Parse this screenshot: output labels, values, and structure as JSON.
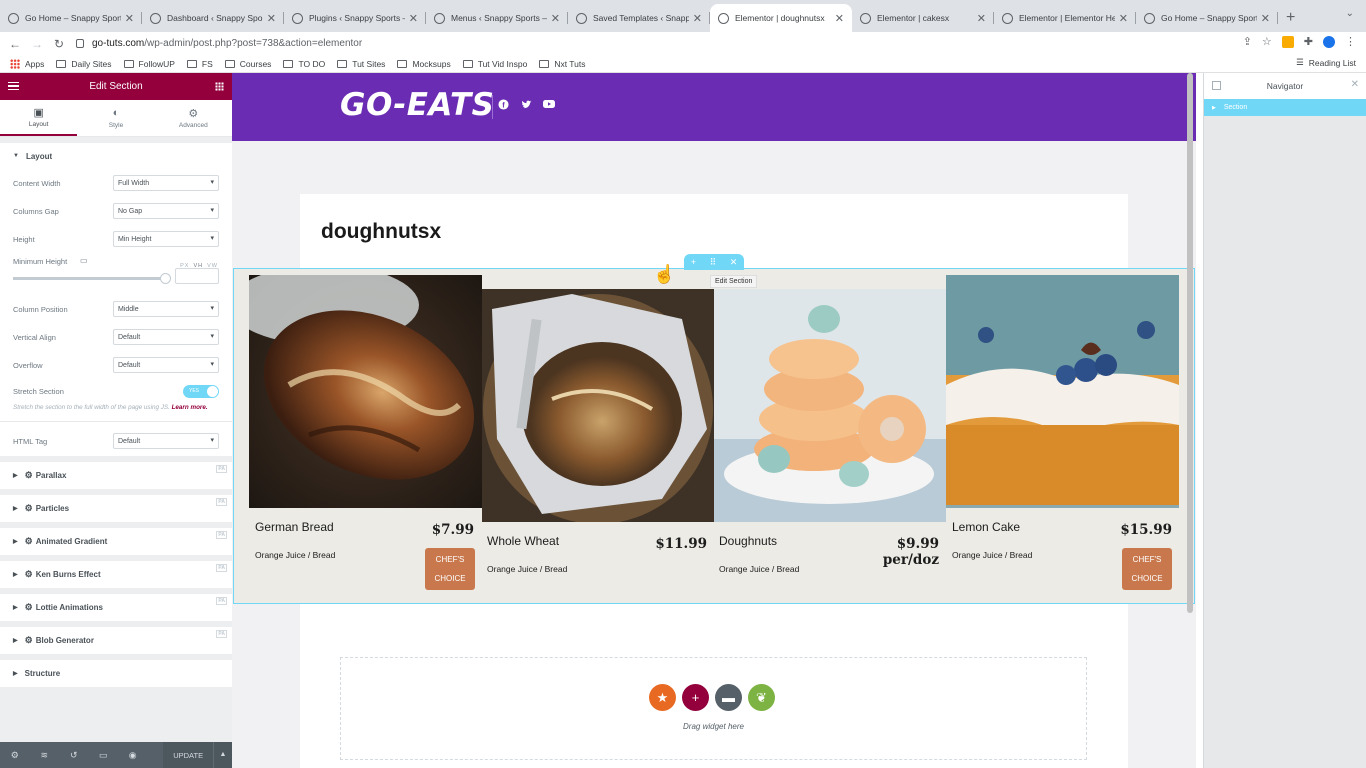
{
  "browser": {
    "tabs": [
      {
        "title": "Go Home – Snappy Sports"
      },
      {
        "title": "Dashboard ‹ Snappy Sports"
      },
      {
        "title": "Plugins ‹ Snappy Sports —"
      },
      {
        "title": "Menus ‹ Snappy Sports —"
      },
      {
        "title": "Saved Templates ‹ Snappy"
      },
      {
        "title": "Elementor | doughnutsx",
        "active": true
      },
      {
        "title": "Elementor | cakesx"
      },
      {
        "title": "Elementor | Elementor He"
      },
      {
        "title": "Go Home – Snappy Sports"
      }
    ],
    "url_host": "go-tuts.com",
    "url_path": "/wp-admin/post.php?post=738&action=elementor",
    "bookmarks": [
      "Apps",
      "Daily Sites",
      "FollowUP",
      "FS",
      "Courses",
      "TO DO",
      "Tut Sites",
      "Mocksups",
      "Tut Vid Inspo",
      "Nxt Tuts"
    ],
    "reading_list": "Reading List"
  },
  "panel": {
    "title": "Edit Section",
    "tabs": [
      "Layout",
      "Style",
      "Advanced"
    ],
    "layout_section": "Layout",
    "fields": {
      "content_width": {
        "label": "Content Width",
        "value": "Full Width"
      },
      "columns_gap": {
        "label": "Columns Gap",
        "value": "No Gap"
      },
      "height": {
        "label": "Height",
        "value": "Min Height"
      },
      "min_height": {
        "label": "Minimum Height",
        "units": [
          "PX",
          "VH",
          "VW"
        ],
        "active_unit": "VH",
        "slider_fraction": 0.97
      },
      "column_position": {
        "label": "Column Position",
        "value": "Middle"
      },
      "vertical_align": {
        "label": "Vertical Align",
        "value": "Default"
      },
      "overflow": {
        "label": "Overflow",
        "value": "Default"
      },
      "stretch": {
        "label": "Stretch Section",
        "toggle_text": "YES",
        "on": true
      },
      "stretch_help": "Stretch the section to the full width of the page using JS.",
      "stretch_help_link": "Learn more.",
      "html_tag": {
        "label": "HTML Tag",
        "value": "Default"
      }
    },
    "addon_sections": [
      "Parallax",
      "Particles",
      "Animated Gradient",
      "Ken Burns Effect",
      "Lottie Animations",
      "Blob Generator"
    ],
    "structure": "Structure",
    "update_label": "UPDATE"
  },
  "canvas": {
    "logo": "GO-EATS",
    "page_title": "doughnutsx",
    "section_tooltip": "Edit Section",
    "items": [
      {
        "title": "German Bread",
        "price": "$7.99",
        "desc": "Orange Juice / Bread",
        "badge": [
          "CHEF'S",
          "CHOICE"
        ]
      },
      {
        "title": "Whole Wheat",
        "price": "$11.99",
        "desc": "Orange Juice / Bread"
      },
      {
        "title": "Doughnuts",
        "price": "$9.99",
        "price_sub": "per/doz",
        "desc": "Orange Juice / Bread"
      },
      {
        "title": "Lemon Cake",
        "price": "$15.99",
        "desc": "Orange Juice / Bread",
        "badge": [
          "CHEF'S",
          "CHOICE"
        ]
      }
    ],
    "drop_text": "Drag widget here"
  },
  "navigator": {
    "title": "Navigator",
    "items": [
      "Section"
    ]
  },
  "colors": {
    "elementor_primary": "#93003c",
    "header_purple": "#6a2cb2",
    "selection_blue": "#71d7f7",
    "chef_badge": "#c8784c"
  }
}
